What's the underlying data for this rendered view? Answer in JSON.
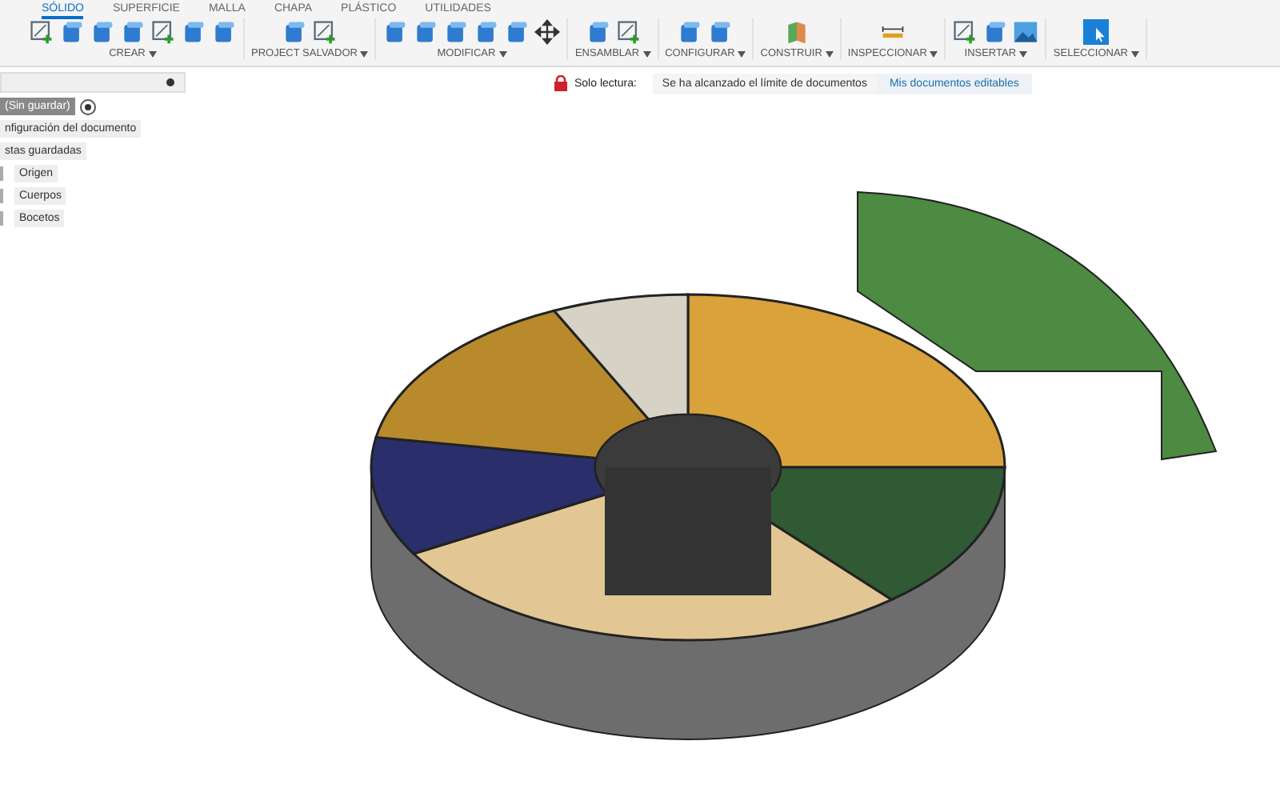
{
  "tabs": [
    {
      "label": "SÓLIDO",
      "selected": true
    },
    {
      "label": "SUPERFICIE",
      "selected": false
    },
    {
      "label": "MALLA",
      "selected": false
    },
    {
      "label": "CHAPA",
      "selected": false
    },
    {
      "label": "PLÁSTICO",
      "selected": false
    },
    {
      "label": "UTILIDADES",
      "selected": false
    }
  ],
  "toolbar_groups": [
    {
      "label": "CREAR"
    },
    {
      "label": "PROJECT SALVADOR"
    },
    {
      "label": "MODIFICAR"
    },
    {
      "label": "ENSAMBLAR"
    },
    {
      "label": "CONFIGURAR"
    },
    {
      "label": "CONSTRUIR"
    },
    {
      "label": "INSPECCIONAR"
    },
    {
      "label": "INSERTAR"
    },
    {
      "label": "SELECCIONAR"
    }
  ],
  "browser": {
    "items": [
      {
        "label": "(Sin guardar)",
        "kind": "root"
      },
      {
        "label": "nfiguración del documento",
        "kind": "node"
      },
      {
        "label": "stas guardadas",
        "kind": "node"
      },
      {
        "label": "Origen",
        "kind": "child"
      },
      {
        "label": "Cuerpos",
        "kind": "child"
      },
      {
        "label": "Bocetos",
        "kind": "child"
      }
    ]
  },
  "banner": {
    "label": "Solo lectura:",
    "message": "Se ha alcanzado el límite de documentos",
    "link": "Mis documentos editables"
  }
}
